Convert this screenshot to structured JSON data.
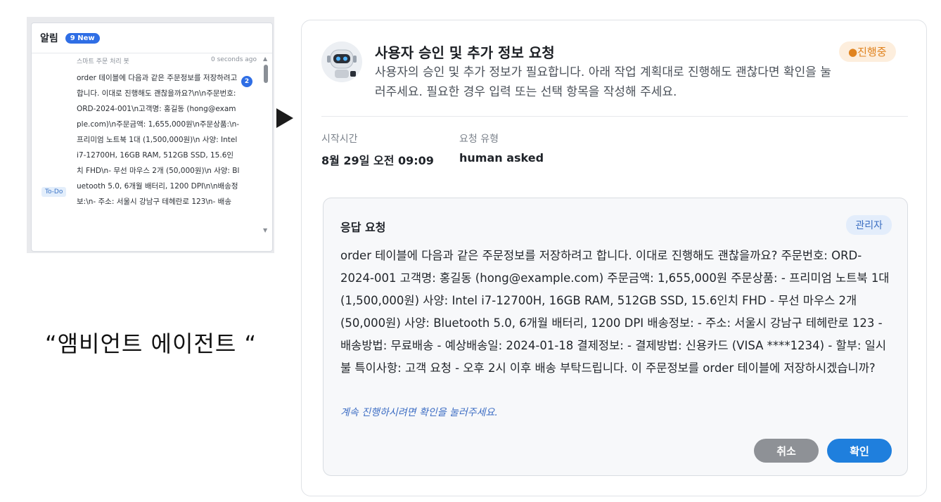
{
  "notification": {
    "title": "알림",
    "new_badge": "9 New",
    "sender": "스마트 주문 처리 봇",
    "time": "0 seconds ago",
    "count": "2",
    "tag": "To-Do",
    "message": "order 테이블에 다음과 같은 주문정보를 저장하려고 합니다. 이대로 진행해도 괜찮을까요?\\n\\n주문번호: ORD-2024-001\\n고객명: 홍길동 (hong@example.com)\\n주문금액: 1,655,000원\\n주문상품:\\n- 프리미엄 노트북 1대 (1,500,000원)\\n 사양: Intel i7-12700H, 16GB RAM, 512GB SSD, 15.6인치 FHD\\n- 무선 마우스 2개 (50,000원)\\n 사양: Bluetooth 5.0, 6개월 배터리, 1200 DPI\\n\\n배송정보:\\n- 주소: 서울시 강남구 테헤란로 123\\n- 배송"
  },
  "caption": "“앰비언트 에이전트 “",
  "card": {
    "title": "사용자 승인 및 추가 정보 요청",
    "description": "사용자의 승인 및 추가 정보가 필요합니다. 아래 작업 계획대로 진행해도 괜찮다면 확인을 눌러주세요. 필요한 경우 입력 또는 선택 항목을 작성해 주세요.",
    "status": "●진행중",
    "start_time_label": "시작시간",
    "start_time_value": "8월 29일 오전 09:09",
    "request_type_label": "요청 유형",
    "request_type_value": "human asked",
    "response": {
      "title": "응답 요청",
      "role_badge": "관리자",
      "text": "order 테이블에 다음과 같은 주문정보를 저장하려고 합니다. 이대로 진행해도 괜찮을까요? 주문번호: ORD-2024-001 고객명: 홍길동 (hong@example.com) 주문금액: 1,655,000원 주문상품: - 프리미엄 노트북 1대 (1,500,000원) 사양: Intel i7-12700H, 16GB RAM, 512GB SSD, 15.6인치 FHD - 무선 마우스 2개 (50,000원) 사양: Bluetooth 5.0, 6개월 배터리, 1200 DPI 배송정보: - 주소: 서울시 강남구 테헤란로 123 - 배송방법: 무료배송 - 예상배송일: 2024-01-18 결제정보: - 결제방법: 신용카드 (VISA ****1234) - 할부: 일시불 특이사항: 고객 요청 - 오후 2시 이후 배송 부탁드립니다. 이 주문정보를 order 테이블에 저장하시겠습니까?",
      "hint": "계속 진행하시려면 확인을 눌러주세요.",
      "cancel_label": "취소",
      "confirm_label": "확인"
    }
  }
}
